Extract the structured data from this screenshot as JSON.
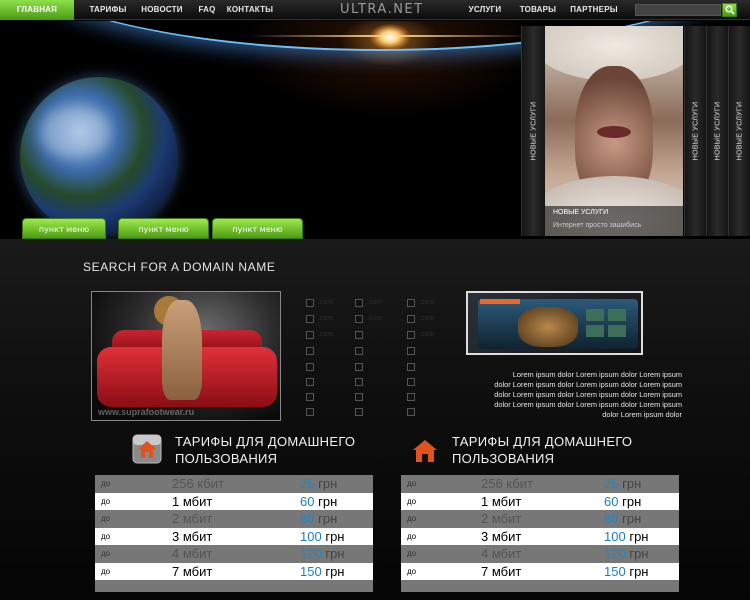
{
  "nav": {
    "left_items": [
      "ГЛАВНАЯ",
      "ТАРИФЫ",
      "НОВОСТИ",
      "FAQ",
      "КОНТАКТЫ"
    ],
    "brand": "ULTRA.NET",
    "right_items": [
      "УСЛУГИ",
      "ТОВАРЫ",
      "ПАРТНЕРЫ"
    ],
    "search_placeholder": ""
  },
  "header": {
    "menu_pills": [
      "пункт меню",
      "пункт меню",
      "пункт меню"
    ],
    "side_tabs": [
      "НОВЫЕ УСЛУГИ",
      "НОВЫЕ УСЛУГИ",
      "НОВЫЕ УСЛУГИ",
      "НОВЫЕ УСЛУГИ"
    ],
    "photo_caption_title": "НОВЫЕ УСЛУГИ",
    "photo_caption_text": "Интернет просто зашибись"
  },
  "domain": {
    "title": "SEARCH FOR A DOMAIN NAME",
    "watermark": "www.suprafootwear.ru",
    "checkbox_labels": [
      ".com",
      ".com",
      ".com",
      ".com",
      ".com",
      ".com",
      ".com",
      ".com"
    ]
  },
  "lorem": {
    "lines": [
      "Lorem ipsum dolor Lorem ipsum dolor Lorem ipsum",
      "dolor Lorem ipsum dolor Lorem ipsum dolor Lorem ipsum",
      "dolor Lorem ipsum dolor Lorem ipsum dolor Lorem ipsum",
      "dolor Lorem ipsum dolor Lorem ipsum dolor Lorem ipsum",
      "dolor Lorem ipsum dolor"
    ]
  },
  "tariffs": [
    {
      "title_line1": "ТАРИФЫ ДЛЯ ДОМАШНЕГО",
      "title_line2": "ПОЛЬЗОВАНИЯ",
      "rows": [
        {
          "prefix": "до",
          "speed": "256 кбит",
          "price": "25",
          "currency": "грн"
        },
        {
          "prefix": "до",
          "speed": "1 мбит",
          "price": "60",
          "currency": "грн"
        },
        {
          "prefix": "до",
          "speed": "2 мбит",
          "price": "80",
          "currency": "грн"
        },
        {
          "prefix": "до",
          "speed": "3 мбит",
          "price": "100",
          "currency": "грн"
        },
        {
          "prefix": "до",
          "speed": "4 мбит",
          "price": "120",
          "currency": "грн"
        },
        {
          "prefix": "до",
          "speed": "7 мбит",
          "price": "150",
          "currency": "грн"
        }
      ]
    },
    {
      "title_line1": "ТАРИФЫ ДЛЯ ДОМАШНЕГО",
      "title_line2": "ПОЛЬЗОВАНИЯ",
      "rows": [
        {
          "prefix": "до",
          "speed": "256 кбит",
          "price": "25",
          "currency": "грн"
        },
        {
          "prefix": "до",
          "speed": "1 мбит",
          "price": "60",
          "currency": "грн"
        },
        {
          "prefix": "до",
          "speed": "2 мбит",
          "price": "80",
          "currency": "грн"
        },
        {
          "prefix": "до",
          "speed": "3 мбит",
          "price": "100",
          "currency": "грн"
        },
        {
          "prefix": "до",
          "speed": "4 мбит",
          "price": "120",
          "currency": "грн"
        },
        {
          "prefix": "до",
          "speed": "7 мбит",
          "price": "150",
          "currency": "грн"
        }
      ]
    }
  ],
  "colors": {
    "accent_green": "#5fb81e",
    "price_blue": "#1b7fc0",
    "home_icon_orange": "#e0521e"
  },
  "icons": [
    "search-icon",
    "home-icon"
  ]
}
